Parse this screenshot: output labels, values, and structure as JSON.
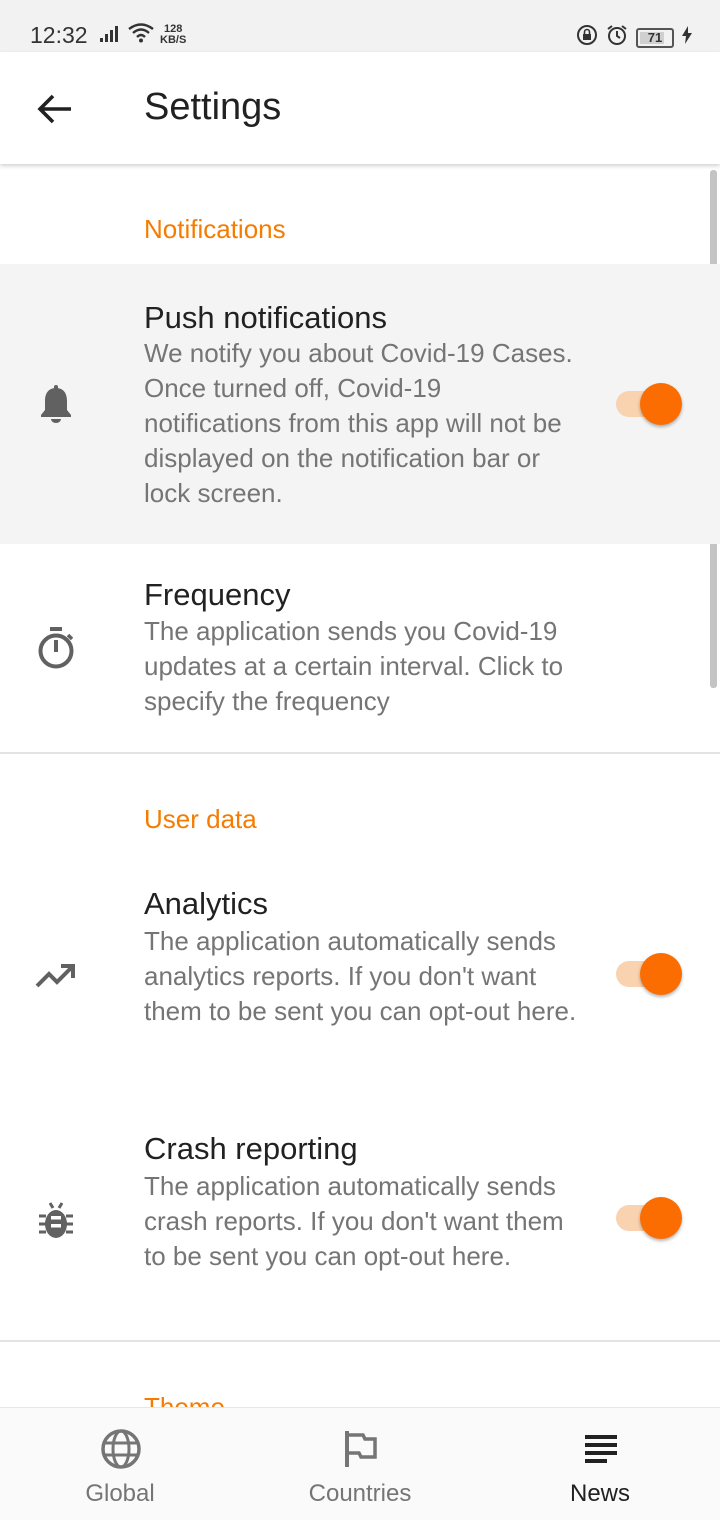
{
  "status_bar": {
    "time": "12:32",
    "network_speed_value": "128",
    "network_speed_unit": "KB/S",
    "battery": "71"
  },
  "app_bar": {
    "title": "Settings"
  },
  "sections": {
    "notifications": {
      "header": "Notifications",
      "push": {
        "title": "Push notifications",
        "summary": "We notify you about Covid-19 Cases. Once turned off, Covid-19 notifications from this app will not be displayed on the notification bar or lock screen.",
        "enabled": true
      },
      "frequency": {
        "title": "Frequency",
        "summary": "The application sends you Covid-19 updates at a certain interval. Click to specify the frequency"
      }
    },
    "user_data": {
      "header": "User data",
      "analytics": {
        "title": "Analytics",
        "summary": "The application automatically sends analytics reports. If you don't want them to be sent you can opt-out here.",
        "enabled": true
      },
      "crash": {
        "title": "Crash reporting",
        "summary": "The application automatically sends crash reports. If you don't want them to be sent you can opt-out here.",
        "enabled": true
      }
    },
    "theme": {
      "header": "Theme"
    }
  },
  "bottom_nav": {
    "items": [
      {
        "label": "Global",
        "icon": "globe-icon"
      },
      {
        "label": "Countries",
        "icon": "flag-icon"
      },
      {
        "label": "News",
        "icon": "news-icon",
        "active": true
      }
    ]
  },
  "colors": {
    "accent": "#f57c00",
    "switch_thumb": "#fb6d00",
    "switch_track": "#f9d2b0"
  }
}
